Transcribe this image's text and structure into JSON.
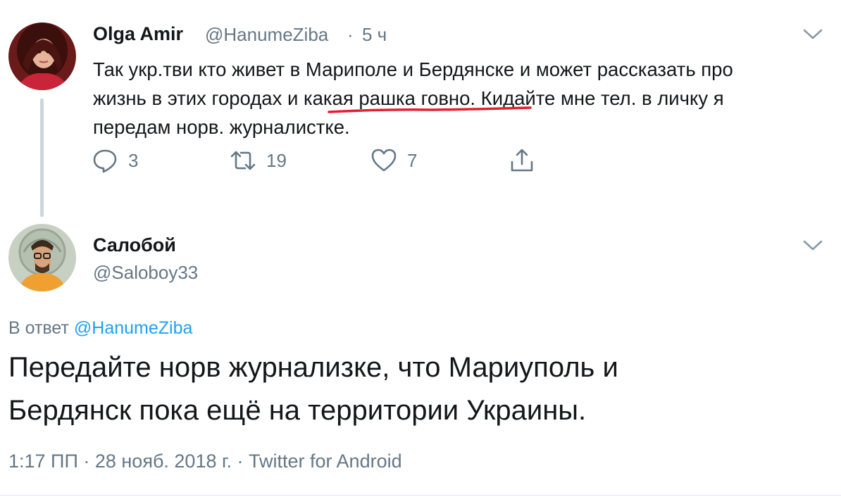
{
  "tweet1": {
    "name": "Olga Amir",
    "handle": "@HanumeZiba",
    "separator": "·",
    "time": "5 ч",
    "text_lines": [
      "Так укр.тви кто живет в Мариполе и Бердянске и может рассказать про",
      "жизнь в этих городах и какая рашка говно. Кидайте мне тел. в личку я",
      "передам норв. журналистке."
    ],
    "actions": {
      "reply_count": "3",
      "retweet_count": "19",
      "like_count": "7"
    },
    "icons": {
      "reply": "reply-icon",
      "retweet": "retweet-icon",
      "like": "heart-icon",
      "share": "share-icon",
      "menu": "chevron-down-icon"
    },
    "annotation_color": "#e0202e"
  },
  "tweet2": {
    "name": "Салобой",
    "handle": "@Saloboy33",
    "reply_prefix": "В ответ",
    "reply_handle": "@HanumeZiba",
    "text_lines": [
      "Передайте норв журнализке, что Мариуполь и",
      "Бердянск пока ещё на территории Украины."
    ],
    "footer": "1:17 ПП · 28 нояб. 2018 г. · Twitter for Android"
  },
  "colors": {
    "text": "#14171a",
    "secondary": "#657786",
    "link": "#1da1f2",
    "thread_line": "#ccd6dd"
  }
}
